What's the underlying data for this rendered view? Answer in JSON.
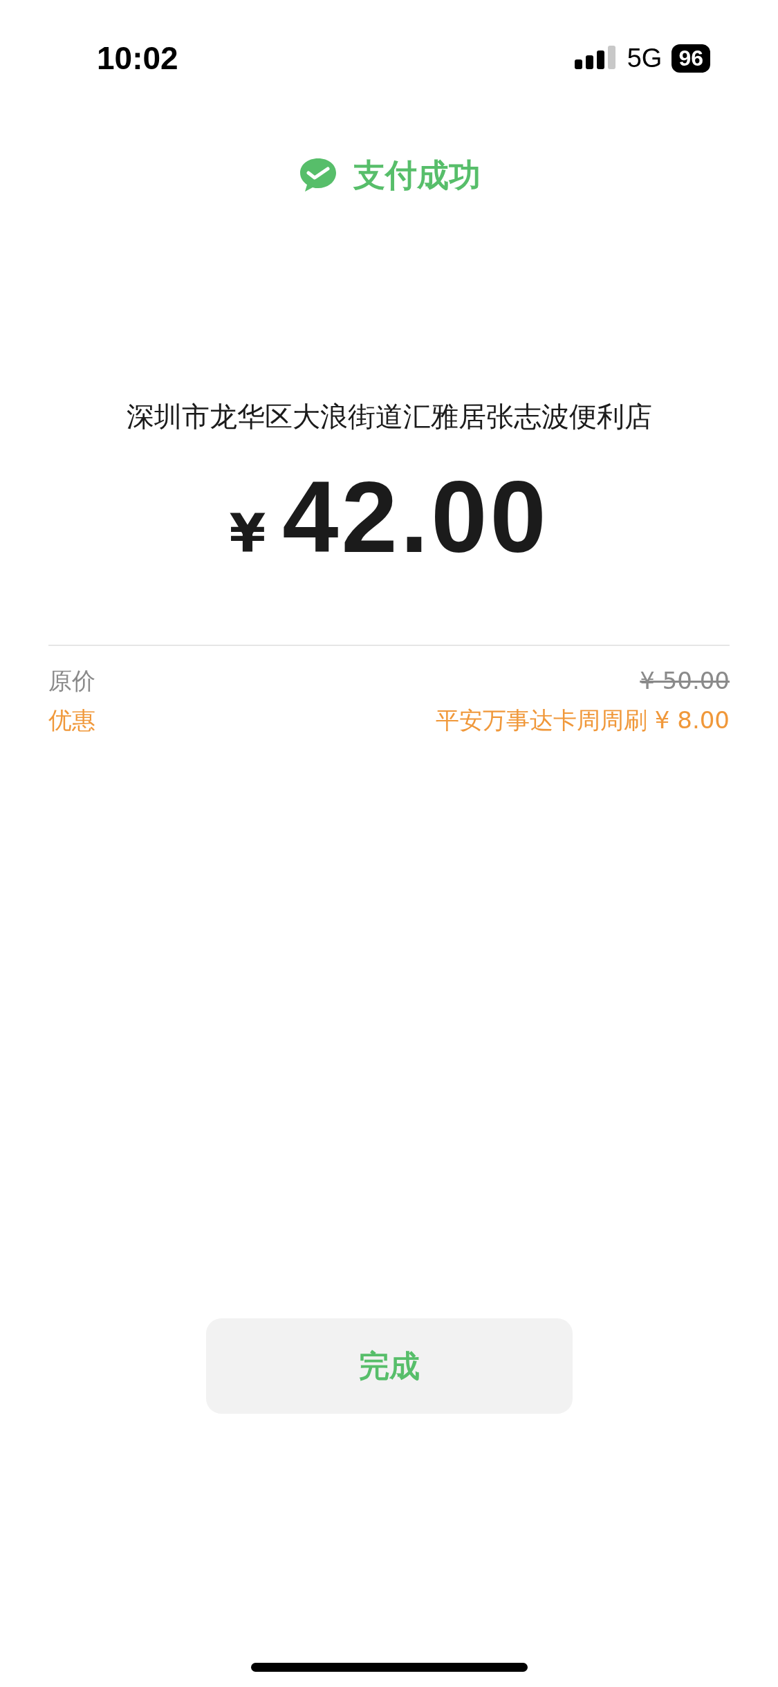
{
  "status_bar": {
    "time": "10:02",
    "network": "5G",
    "battery": "96"
  },
  "header": {
    "title": "支付成功"
  },
  "merchant": "深圳市龙华区大浪街道汇雅居张志波便利店",
  "amount": {
    "currency": "¥",
    "value": "42.00"
  },
  "details": [
    {
      "kind": "original",
      "label": "原价",
      "value": "¥ 50.00",
      "struck": true
    },
    {
      "kind": "discount",
      "label": "优惠",
      "value": "平安万事达卡周周刷 ¥ 8.00",
      "struck": false
    }
  ],
  "buttons": [
    {
      "label": "完成"
    }
  ]
}
